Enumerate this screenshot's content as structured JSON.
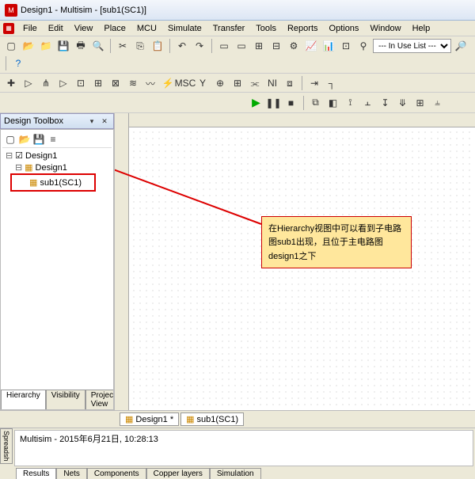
{
  "title": "Design1 - Multisim - [sub1(SC1)]",
  "menu": [
    "File",
    "Edit",
    "View",
    "Place",
    "MCU",
    "Simulate",
    "Transfer",
    "Tools",
    "Reports",
    "Options",
    "Window",
    "Help"
  ],
  "toolbar1": {
    "use_list": "--- In Use List ---"
  },
  "sidebar": {
    "title": "Design Toolbox",
    "tree": {
      "root": "Design1",
      "child": "Design1",
      "leaf": "sub1(SC1)"
    },
    "tabs": [
      "Hierarchy",
      "Visibility",
      "Project View"
    ]
  },
  "callout": "在Hierarchy视图中可以看到子电路图sub1出现，且位于主电路图design1之下",
  "doc_tabs": [
    "Design1 *",
    "sub1(SC1)"
  ],
  "status_text": "Multisim  -  2015年6月21日, 10:28:13",
  "status_tabs": [
    "Results",
    "Nets",
    "Components",
    "Copper layers",
    "Simulation"
  ]
}
